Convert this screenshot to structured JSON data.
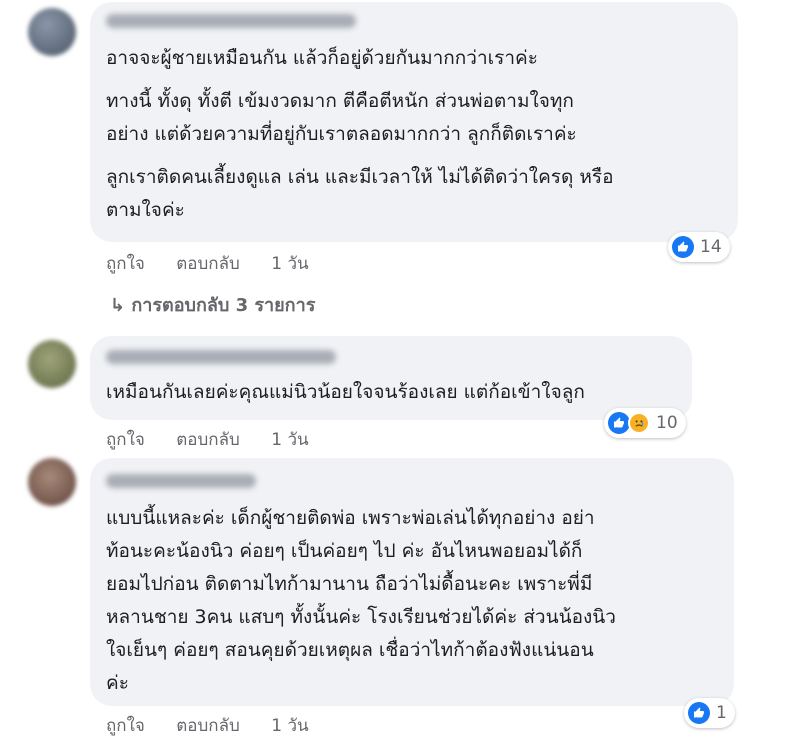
{
  "comments": [
    {
      "paragraphs": [
        "อาจจะผู้ชายเหมือนกัน แล้วก็อยู่ด้วยกันมากกว่าเราค่ะ",
        "ทางนี้ ทั้งดุ ทั้งตี เข้มงวดมาก ตีคือตีหนัก ส่วนพ่อตามใจทุก\nอย่าง แต่ด้วยความที่อยู่กับเราตลอดมากกว่า ลูกก็ติดเราค่ะ",
        "ลูกเราติดคนเลี้ยงดูแล เล่น และมีเวลาให้ ไม่ได้ติดว่าใครดุ หรือ\nตามใจค่ะ"
      ],
      "like": "ถูกใจ",
      "reply": "ตอบกลับ",
      "time": "1 วัน",
      "reaction_count": "14",
      "reaction_icons": [
        "like-icon"
      ],
      "view_replies": "↳ การตอบกลับ 3 รายการ"
    },
    {
      "paragraphs": [
        "เหมือนกันเลยค่ะคุณแม่นิวน้อยใจจนร้องเลย แต่ก้อเข้าใจลูก"
      ],
      "like": "ถูกใจ",
      "reply": "ตอบกลับ",
      "time": "1 วัน",
      "reaction_count": "10",
      "reaction_icons": [
        "like-icon",
        "sad-icon"
      ]
    },
    {
      "paragraphs": [
        "แบบนี้แหละค่ะ เด็กผู้ชายติดพ่อ เพราะพ่อเล่นได้ทุกอย่าง อย่า\nท้อนะคะน้องนิว ค่อยๆ เป็นค่อยๆ ไป ค่ะ อันไหนพอยอมได้ก็\nยอมไปก่อน ติดตามไทก้ามานาน ถือว่าไม่ดื้อนะคะ เพราะพี่มี\nหลานชาย 3คน แสบๆ ทั้งนั้นค่ะ โรงเรียนช่วยได้ค่ะ ส่วนน้องนิว\nใจเย็นๆ ค่อยๆ สอนคุยด้วยเหตุผล เชื่อว่าไทก้าต้องฟังแน่นอน\nค่ะ"
      ],
      "like": "ถูกใจ",
      "reply": "ตอบกลับ",
      "time": "1 วัน",
      "reaction_count": "1",
      "reaction_icons": [
        "like-icon"
      ]
    }
  ],
  "colors": {
    "bubble": "#f0f2f5",
    "meta_text": "#65676b",
    "like_blue": "#1877f2",
    "sad_yellow": "#f7b125"
  }
}
